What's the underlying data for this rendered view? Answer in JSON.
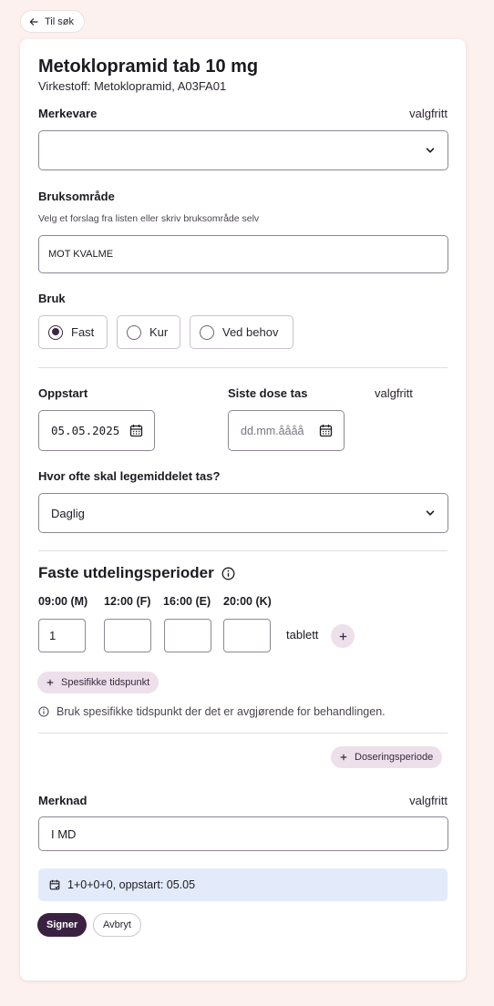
{
  "nav": {
    "back_label": "Til søk"
  },
  "header": {
    "title": "Metoklopramid tab 10 mg",
    "subtitle": "Virkestoff: Metoklopramid, A03FA01"
  },
  "brand": {
    "label": "Merkevare",
    "optional": "valgfritt",
    "value": ""
  },
  "usage_area": {
    "label": "Bruksområde",
    "hint": "Velg et forslag fra listen eller skriv bruksområde selv",
    "value": "MOT KVALME"
  },
  "usage": {
    "label": "Bruk",
    "options": [
      {
        "label": "Fast",
        "selected": true
      },
      {
        "label": "Kur",
        "selected": false
      },
      {
        "label": "Ved behov",
        "selected": false
      }
    ]
  },
  "start": {
    "label": "Oppstart",
    "value": "05.05.2025"
  },
  "last_dose": {
    "label": "Siste dose tas",
    "optional": "valgfritt",
    "placeholder": "dd.mm.åååå"
  },
  "frequency": {
    "label": "Hvor ofte skal legemiddelet tas?",
    "value": "Daglig"
  },
  "dispensing": {
    "title": "Faste utdelingsperioder",
    "times": [
      "09:00 (M)",
      "12:00 (F)",
      "16:00 (E)",
      "20:00 (K)"
    ],
    "doses": [
      "1",
      "",
      "",
      ""
    ],
    "unit": "tablett",
    "specific_times_label": "Spesifikke tidspunkt",
    "info_text": "Bruk spesifikke tidspunkt der det er avgjørende for behandlingen.",
    "dosing_period_label": "Doseringsperiode"
  },
  "note": {
    "label": "Merknad",
    "optional": "valgfritt",
    "value": "I MD"
  },
  "summary": {
    "text": "1+0+0+0, oppstart: 05.05"
  },
  "actions": {
    "sign_label": "Signer",
    "cancel_label": "Avbryt"
  },
  "colors": {
    "background": "#fdf1ef",
    "primary": "#3b2140",
    "pill": "#eee0ea",
    "summary_bg": "#e3ebfb"
  }
}
